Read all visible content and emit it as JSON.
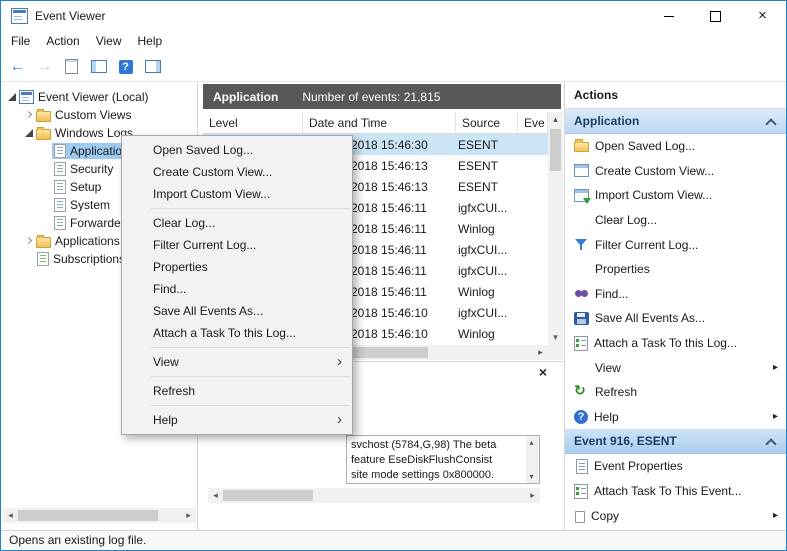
{
  "window": {
    "title": "Event Viewer",
    "status": "Opens an existing log file."
  },
  "menubar": {
    "items": [
      "File",
      "Action",
      "View",
      "Help"
    ]
  },
  "toolbar": {
    "buttons": [
      {
        "name": "back-button",
        "icon": "back"
      },
      {
        "name": "forward-button",
        "icon": "forward"
      },
      {
        "name": "export-list-button",
        "icon": "export"
      },
      {
        "name": "show-console-tree-button",
        "icon": "panes-left"
      },
      {
        "name": "help-button",
        "icon": "qhelp"
      },
      {
        "name": "show-action-pane-button",
        "icon": "panes-right"
      }
    ]
  },
  "tree": {
    "items": [
      {
        "label": "Event Viewer (Local)",
        "level": 0,
        "icon": "viewer",
        "expander": "expanded"
      },
      {
        "label": "Custom Views",
        "level": 1,
        "icon": "folder",
        "expander": "collapsed"
      },
      {
        "label": "Windows Logs",
        "level": 1,
        "icon": "folder",
        "expander": "expanded"
      },
      {
        "label": "Application",
        "level": 2,
        "icon": "log",
        "selected": true
      },
      {
        "label": "Security",
        "level": 2,
        "icon": "log"
      },
      {
        "label": "Setup",
        "level": 2,
        "icon": "log"
      },
      {
        "label": "System",
        "level": 2,
        "icon": "log"
      },
      {
        "label": "Forwarded",
        "level": 2,
        "icon": "log"
      },
      {
        "label": "Applications a",
        "level": 1,
        "icon": "folder",
        "expander": "collapsed"
      },
      {
        "label": "Subscriptions",
        "level": 1,
        "icon": "subs"
      }
    ]
  },
  "main": {
    "title": "Application",
    "count_label": "Number of events: 21,815",
    "columns": [
      {
        "label": "Level"
      },
      {
        "label": "Date and Time"
      },
      {
        "label": "Source"
      },
      {
        "label": "Eve"
      }
    ],
    "rows": [
      {
        "date": "2018 15:46:30",
        "source": "ESENT",
        "selected": true
      },
      {
        "date": "2018 15:46:13",
        "source": "ESENT"
      },
      {
        "date": "2018 15:46:13",
        "source": "ESENT"
      },
      {
        "date": "2018 15:46:11",
        "source": "igfxCUI..."
      },
      {
        "date": "2018 15:46:11",
        "source": "Winlog"
      },
      {
        "date": "2018 15:46:11",
        "source": "igfxCUI..."
      },
      {
        "date": "2018 15:46:11",
        "source": "igfxCUI..."
      },
      {
        "date": "2018 15:46:11",
        "source": "Winlog"
      },
      {
        "date": "2018 15:46:10",
        "source": "igfxCUI..."
      },
      {
        "date": "2018 15:46:10",
        "source": "Winlog"
      }
    ]
  },
  "preview": {
    "line1": "svchost (5784,G,98) The beta feature EseDiskFlushConsist",
    "line2": "site mode settings 0x800000."
  },
  "context_menu": {
    "items": [
      {
        "label": "Open Saved Log..."
      },
      {
        "label": "Create Custom View..."
      },
      {
        "label": "Import Custom View..."
      },
      {
        "type": "separator"
      },
      {
        "label": "Clear Log..."
      },
      {
        "label": "Filter Current Log..."
      },
      {
        "label": "Properties"
      },
      {
        "label": "Find..."
      },
      {
        "label": "Save All Events As..."
      },
      {
        "label": "Attach a Task To this Log..."
      },
      {
        "type": "separator"
      },
      {
        "label": "View",
        "submenu": true
      },
      {
        "type": "separator"
      },
      {
        "label": "Refresh"
      },
      {
        "type": "separator"
      },
      {
        "label": "Help",
        "submenu": true
      }
    ]
  },
  "actions": {
    "title": "Actions",
    "app_header": "Application",
    "event_header": "Event 916, ESENT",
    "app_items": [
      {
        "label": "Open Saved Log...",
        "icon": "openfolder"
      },
      {
        "label": "Create Custom View...",
        "icon": "grid"
      },
      {
        "label": "Import Custom View...",
        "icon": "import"
      },
      {
        "label": "Clear Log...",
        "icon": "none"
      },
      {
        "label": "Filter Current Log...",
        "icon": "funnel"
      },
      {
        "label": "Properties",
        "icon": "none"
      },
      {
        "label": "Find...",
        "icon": "find"
      },
      {
        "label": "Save All Events As...",
        "icon": "save"
      },
      {
        "label": "Attach a Task To this Log...",
        "icon": "task"
      },
      {
        "label": "View",
        "icon": "none",
        "submenu": true
      },
      {
        "label": "Refresh",
        "icon": "refresh"
      },
      {
        "label": "Help",
        "icon": "help",
        "submenu": true
      }
    ],
    "event_items": [
      {
        "label": "Event Properties",
        "icon": "page"
      },
      {
        "label": "Attach Task To This Event...",
        "icon": "task"
      },
      {
        "label": "Copy",
        "icon": "copy",
        "submenu": true
      }
    ]
  }
}
